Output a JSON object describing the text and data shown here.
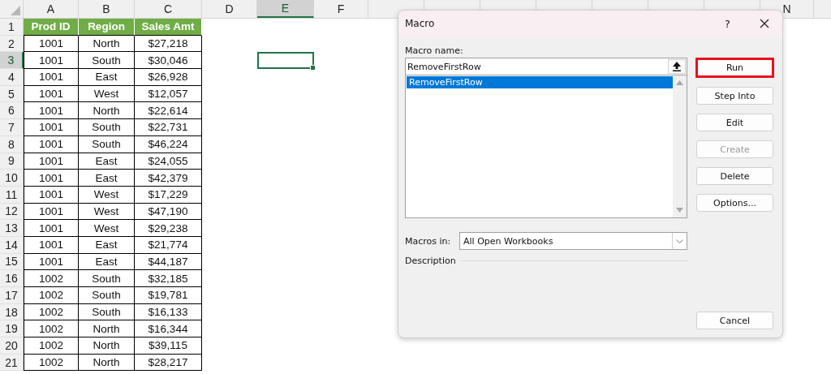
{
  "sheet": {
    "columns": [
      {
        "label": "A",
        "selected": false
      },
      {
        "label": "B",
        "selected": false
      },
      {
        "label": "C",
        "selected": false
      },
      {
        "label": "D",
        "selected": false
      },
      {
        "label": "E",
        "selected": true
      },
      {
        "label": "F",
        "selected": false
      },
      {
        "label": "N",
        "selected": false
      }
    ],
    "rows": [
      {
        "number": "1",
        "selected": false,
        "kind": "header",
        "cells": [
          "Prod ID",
          "Region",
          "Sales Amt"
        ]
      },
      {
        "number": "2",
        "selected": false,
        "kind": "data",
        "cells": [
          "1001",
          "North",
          "$27,218"
        ]
      },
      {
        "number": "3",
        "selected": true,
        "kind": "data",
        "cells": [
          "1001",
          "South",
          "$30,046"
        ]
      },
      {
        "number": "4",
        "selected": false,
        "kind": "data",
        "cells": [
          "1001",
          "East",
          "$26,928"
        ]
      },
      {
        "number": "5",
        "selected": false,
        "kind": "data",
        "cells": [
          "1001",
          "West",
          "$12,057"
        ]
      },
      {
        "number": "6",
        "selected": false,
        "kind": "data",
        "cells": [
          "1001",
          "North",
          "$22,614"
        ]
      },
      {
        "number": "7",
        "selected": false,
        "kind": "data",
        "cells": [
          "1001",
          "South",
          "$22,731"
        ]
      },
      {
        "number": "8",
        "selected": false,
        "kind": "data",
        "cells": [
          "1001",
          "South",
          "$46,224"
        ]
      },
      {
        "number": "9",
        "selected": false,
        "kind": "data",
        "cells": [
          "1001",
          "East",
          "$24,055"
        ]
      },
      {
        "number": "10",
        "selected": false,
        "kind": "data",
        "cells": [
          "1001",
          "East",
          "$42,379"
        ]
      },
      {
        "number": "11",
        "selected": false,
        "kind": "data",
        "cells": [
          "1001",
          "West",
          "$17,229"
        ]
      },
      {
        "number": "12",
        "selected": false,
        "kind": "data",
        "cells": [
          "1001",
          "West",
          "$47,190"
        ]
      },
      {
        "number": "13",
        "selected": false,
        "kind": "data",
        "cells": [
          "1001",
          "West",
          "$29,238"
        ]
      },
      {
        "number": "14",
        "selected": false,
        "kind": "data",
        "cells": [
          "1001",
          "East",
          "$21,774"
        ]
      },
      {
        "number": "15",
        "selected": false,
        "kind": "data",
        "cells": [
          "1001",
          "East",
          "$44,187"
        ]
      },
      {
        "number": "16",
        "selected": false,
        "kind": "data",
        "cells": [
          "1002",
          "South",
          "$32,185"
        ]
      },
      {
        "number": "17",
        "selected": false,
        "kind": "data",
        "cells": [
          "1002",
          "South",
          "$19,781"
        ]
      },
      {
        "number": "18",
        "selected": false,
        "kind": "data",
        "cells": [
          "1002",
          "South",
          "$16,133"
        ]
      },
      {
        "number": "19",
        "selected": false,
        "kind": "data",
        "cells": [
          "1002",
          "North",
          "$16,344"
        ]
      },
      {
        "number": "20",
        "selected": false,
        "kind": "data",
        "cells": [
          "1002",
          "North",
          "$39,115"
        ]
      },
      {
        "number": "21",
        "selected": false,
        "kind": "data",
        "cells": [
          "1002",
          "North",
          "$28,217"
        ]
      }
    ]
  },
  "dialog": {
    "title": "Macro",
    "help": "?",
    "macro_name_label": "Macro name:",
    "macro_name_value": "RemoveFirstRow",
    "macros": [
      {
        "label": "RemoveFirstRow",
        "selected": true
      }
    ],
    "buttons": [
      {
        "label": "Run",
        "disabled": false,
        "highlighted": true
      },
      {
        "label": "Step Into",
        "disabled": false,
        "highlighted": false
      },
      {
        "label": "Edit",
        "disabled": false,
        "highlighted": false
      },
      {
        "label": "Create",
        "disabled": true,
        "highlighted": false
      },
      {
        "label": "Delete",
        "disabled": false,
        "highlighted": false
      },
      {
        "label": "Options...",
        "disabled": false,
        "highlighted": false
      }
    ],
    "cancel": "Cancel",
    "macros_in_label": "Macros in:",
    "macros_in_value": "All Open Workbooks",
    "description_label": "Description"
  }
}
